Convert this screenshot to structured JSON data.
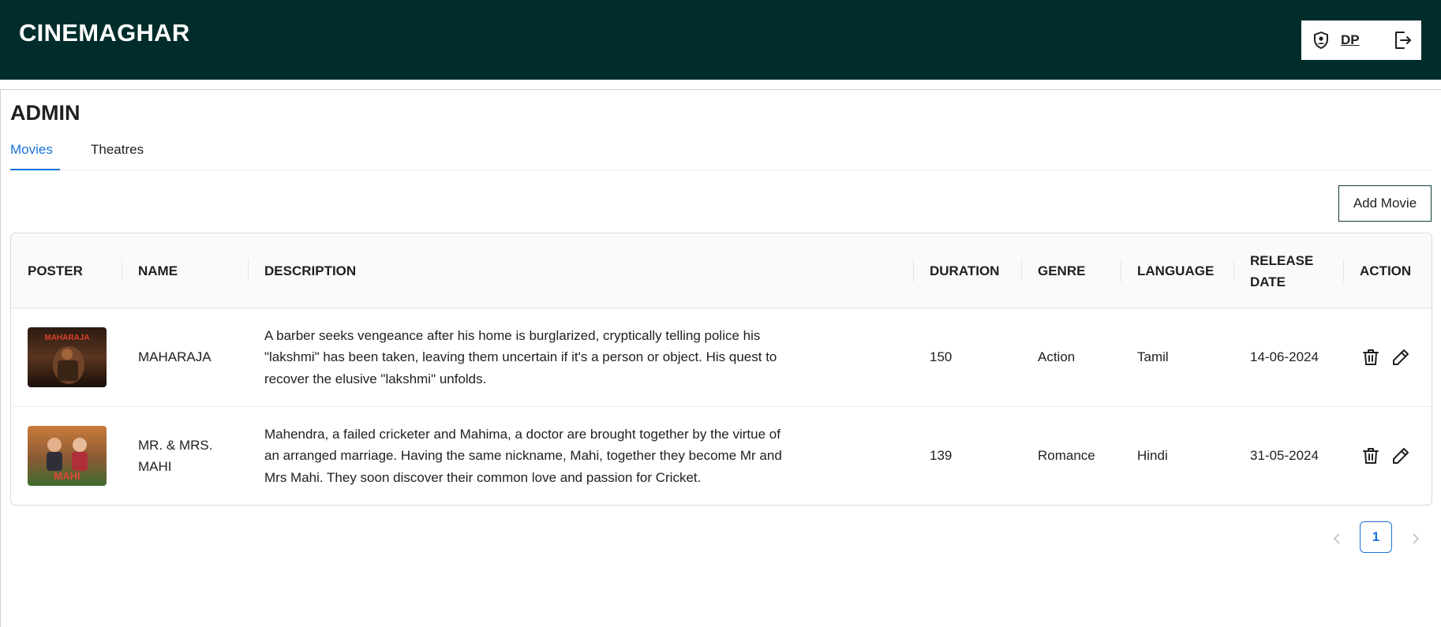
{
  "app": {
    "brand": "CINEMAGHAR"
  },
  "user": {
    "initials": "DP",
    "profile_icon": "shield-user-icon",
    "logout_icon": "logout-icon"
  },
  "page": {
    "title": "ADMIN"
  },
  "tabs": [
    {
      "label": "Movies",
      "active": true
    },
    {
      "label": "Theatres",
      "active": false
    }
  ],
  "toolbar": {
    "add_movie_label": "Add Movie"
  },
  "table": {
    "headers": {
      "poster": "POSTER",
      "name": "NAME",
      "description": "DESCRIPTION",
      "duration": "DURATION",
      "genre": "GENRE",
      "language": "LANGUAGE",
      "release_date_1": "RELEASE",
      "release_date_2": "DATE",
      "action": "ACTION"
    },
    "rows": [
      {
        "name": "MAHARAJA",
        "description_lines": [
          "A barber seeks vengeance after his home is burglarized, cryptically telling police his",
          "\"lakshmi\" has been taken, leaving them uncertain if it's a person or object. His quest to",
          "recover the elusive \"lakshmi\" unfolds."
        ],
        "duration": "150",
        "genre": "Action",
        "language": "Tamil",
        "release_date": "14-06-2024",
        "poster_text": "MAHARAJA"
      },
      {
        "name_lines": [
          "MR. & MRS.",
          "MAHI"
        ],
        "description_lines": [
          "Mahendra, a failed cricketer and Mahima, a doctor are brought together by the virtue of",
          "an arranged marriage. Having the same nickname, Mahi, together they become Mr and",
          "Mrs Mahi. They soon discover their common love and passion for Cricket."
        ],
        "duration": "139",
        "genre": "Romance",
        "language": "Hindi",
        "release_date": "31-05-2024",
        "poster_text": "MAHI"
      }
    ],
    "row_actions": {
      "delete_icon": "trash-icon",
      "edit_icon": "pencil-icon"
    }
  },
  "pagination": {
    "current_page": "1",
    "prev_icon": "chevron-left-icon",
    "next_icon": "chevron-right-icon"
  },
  "colors": {
    "header_bg": "#002d2b",
    "accent": "#1a73d9"
  }
}
